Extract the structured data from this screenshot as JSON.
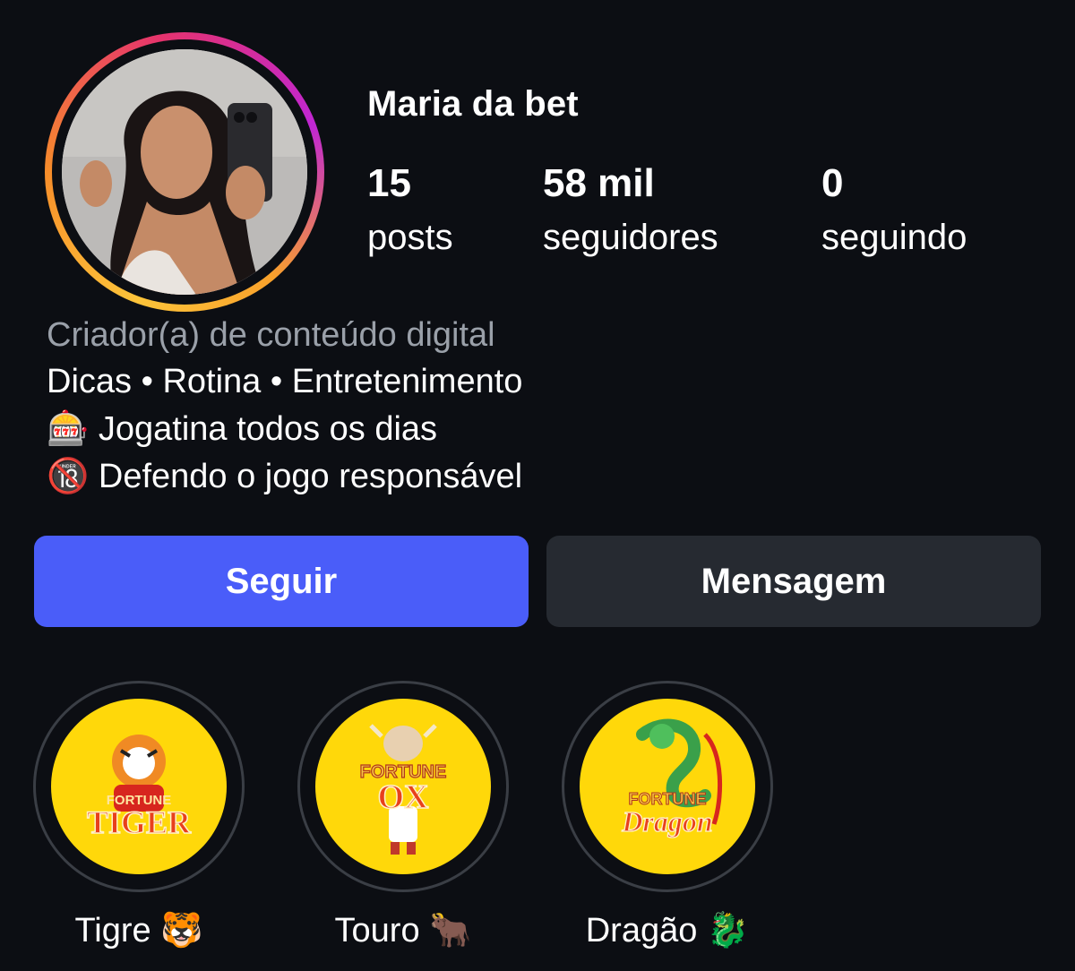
{
  "profile": {
    "username": "Maria da bet",
    "avatar_icon": "profile-photo",
    "ring_colors": [
      "#fdc43a",
      "#f78d2a",
      "#e6336d",
      "#c026d3"
    ]
  },
  "stats": {
    "posts": {
      "value": "15",
      "label": "posts"
    },
    "followers": {
      "value": "58 mil",
      "label": "seguidores"
    },
    "following": {
      "value": "0",
      "label": "seguindo"
    }
  },
  "bio": {
    "category": "Criador(a) de conteúdo digital",
    "line1": "Dicas • Rotina • Entretenimento",
    "line2_emoji": "🎰",
    "line2_text": "Jogatina todos os dias",
    "line3_emoji": "🔞",
    "line3_text": "Defendo o jogo responsável"
  },
  "actions": {
    "follow_label": "Seguir",
    "message_label": "Mensagem",
    "follow_color": "#4a5df9",
    "message_color": "#262a31"
  },
  "highlights": [
    {
      "label": "Tigre 🐯",
      "logo_line1": "FORTUNE",
      "logo_line2": "TIGER",
      "icon": "fortune-tiger-logo"
    },
    {
      "label": "Touro 🐂",
      "logo_line1": "FORTUNE",
      "logo_line2": "OX",
      "icon": "fortune-ox-logo"
    },
    {
      "label": "Dragão 🐉",
      "logo_line1": "FORTUNE",
      "logo_line2": "Dragon",
      "icon": "fortune-dragon-logo"
    }
  ]
}
